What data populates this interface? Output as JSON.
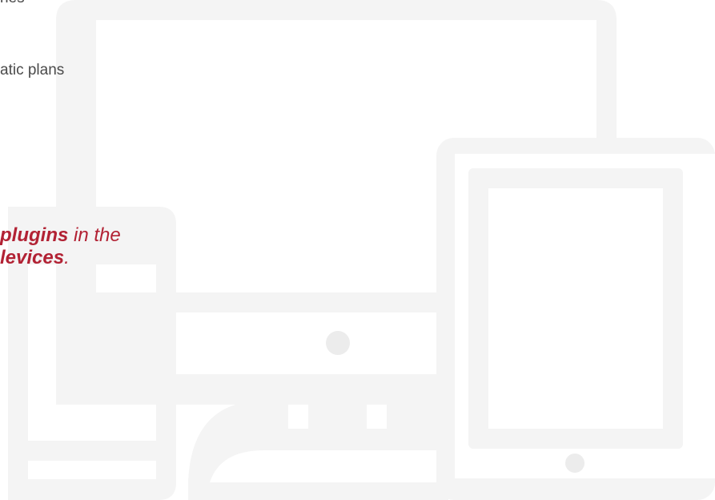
{
  "features": {
    "line1": "ries",
    "line2": "atic plans"
  },
  "tagline": {
    "line1_strong": "plugins",
    "line1_rest": " in the",
    "line2_strong": "levices",
    "line2_rest": "."
  },
  "colors": {
    "illustration_gray": "#f4f4f4",
    "accent_red": "#b22234",
    "body_text": "#4a4a4a"
  },
  "icons": [
    "monitor-icon",
    "tablet-icon",
    "phone-icon"
  ]
}
